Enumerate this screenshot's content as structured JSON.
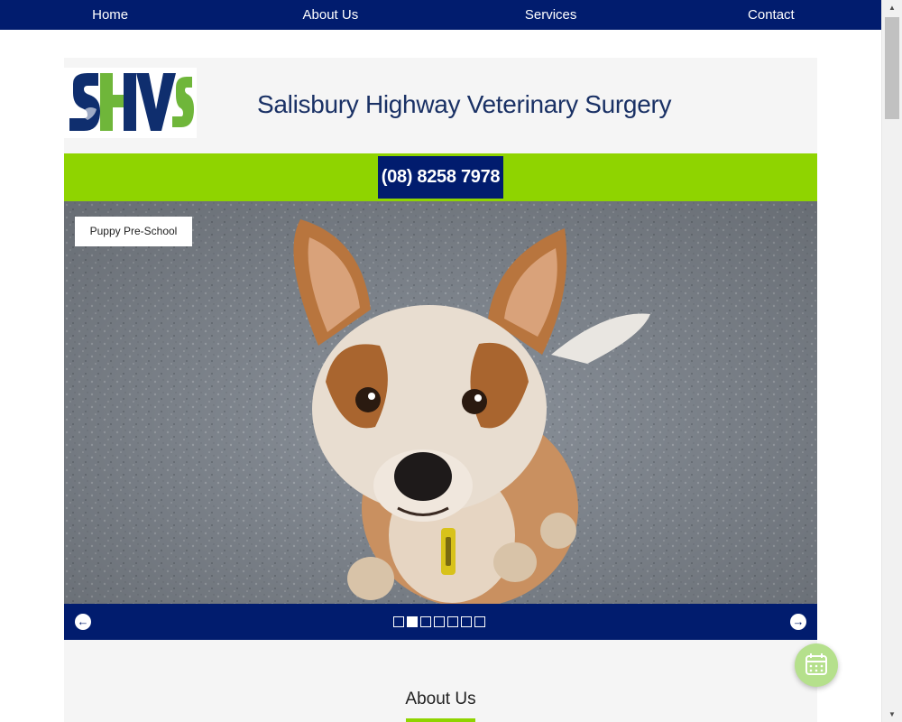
{
  "nav": {
    "items": [
      {
        "label": "Home"
      },
      {
        "label": "About Us"
      },
      {
        "label": "Services"
      },
      {
        "label": "Contact"
      }
    ]
  },
  "header": {
    "logo_text": "SHVS",
    "title": "Salisbury Highway Veterinary Surgery"
  },
  "phone": "(08) 8258 7978",
  "slider": {
    "caption": "Puppy Pre-School",
    "slide_count": 7,
    "active_slide": 2
  },
  "about": {
    "heading": "About Us"
  },
  "icons": {
    "prev": "arrow-left-icon",
    "next": "arrow-right-icon",
    "fab": "calendar-icon"
  },
  "colors": {
    "navy": "#011c6e",
    "green": "#8fd400",
    "title": "#1a3165",
    "fab": "#b5e08c"
  }
}
